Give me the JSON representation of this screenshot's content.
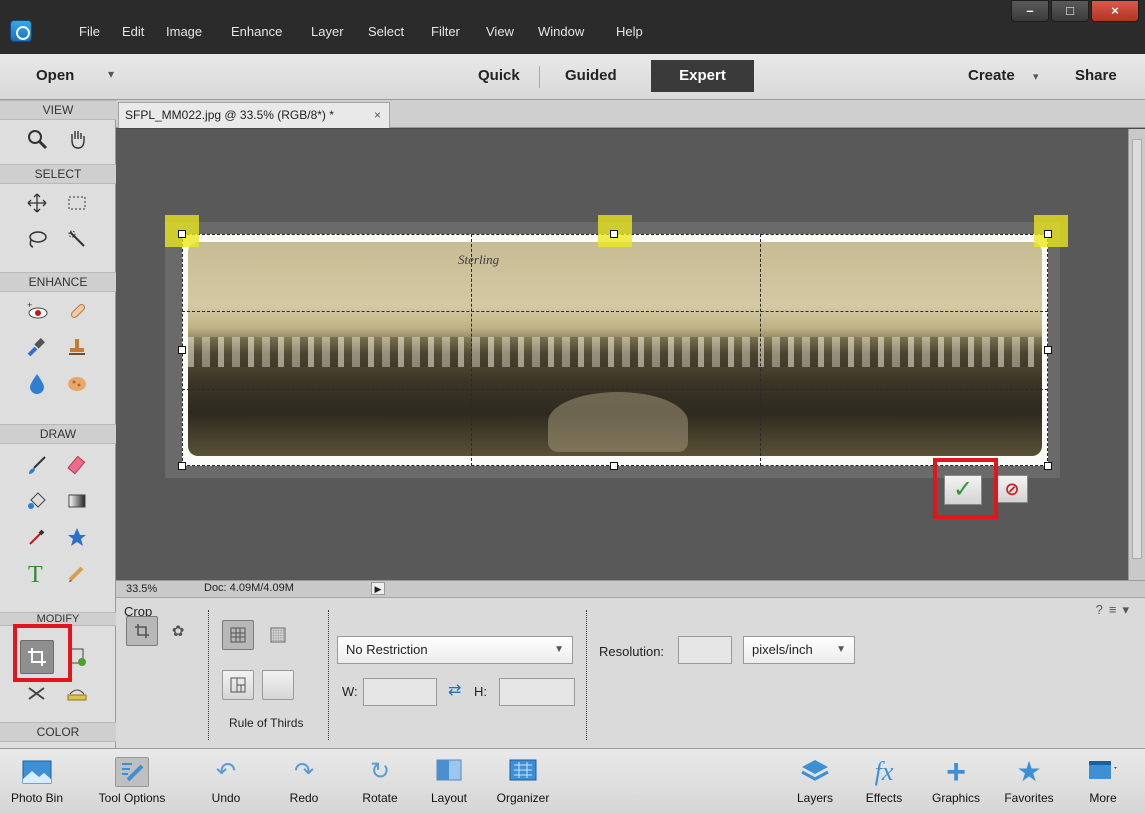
{
  "menu": {
    "items": [
      "File",
      "Edit",
      "Image",
      "Enhance",
      "Layer",
      "Select",
      "Filter",
      "View",
      "Window",
      "Help"
    ]
  },
  "window_controls": {
    "minimize": "–",
    "maximize": "□",
    "close": "×"
  },
  "modebar": {
    "open_label": "Open",
    "tabs": [
      "Quick",
      "Guided",
      "Expert"
    ],
    "active_tab": "Expert",
    "create_label": "Create",
    "share_label": "Share"
  },
  "toolbox": {
    "sections": [
      "VIEW",
      "SELECT",
      "ENHANCE",
      "DRAW",
      "MODIFY",
      "COLOR"
    ]
  },
  "document": {
    "tab_title": "SFPL_MM022.jpg @ 33.5% (RGB/8*) *",
    "tab_close": "×",
    "photo_text": "Sterling"
  },
  "statusbar": {
    "zoom": "33.5%",
    "doc_size": "Doc: 4.09M/4.09M"
  },
  "tool_options": {
    "tool_name": "Crop",
    "aspect_ratio": "No Restriction",
    "width_label": "W:",
    "height_label": "H:",
    "width_value": "",
    "height_value": "",
    "resolution_label": "Resolution:",
    "resolution_value": "",
    "resolution_unit": "pixels/inch",
    "overlay_label": "Rule of Thirds"
  },
  "bottombar": {
    "items": [
      {
        "label": "Photo Bin",
        "icon": "photo-bin-icon"
      },
      {
        "label": "Tool Options",
        "icon": "tool-options-icon"
      },
      {
        "label": "Undo",
        "icon": "undo-icon"
      },
      {
        "label": "Redo",
        "icon": "redo-icon"
      },
      {
        "label": "Rotate",
        "icon": "rotate-icon"
      },
      {
        "label": "Layout",
        "icon": "layout-icon"
      },
      {
        "label": "Organizer",
        "icon": "organizer-icon"
      },
      {
        "label": "Layers",
        "icon": "layers-icon"
      },
      {
        "label": "Effects",
        "icon": "effects-icon"
      },
      {
        "label": "Graphics",
        "icon": "graphics-icon"
      },
      {
        "label": "Favorites",
        "icon": "favorites-icon"
      },
      {
        "label": "More",
        "icon": "more-icon"
      }
    ]
  },
  "colors": {
    "accent_red": "#e3141b",
    "handle_highlight": "#ece91e",
    "commit_green": "#2a9a2a",
    "cancel_red": "#cc1f2a"
  }
}
